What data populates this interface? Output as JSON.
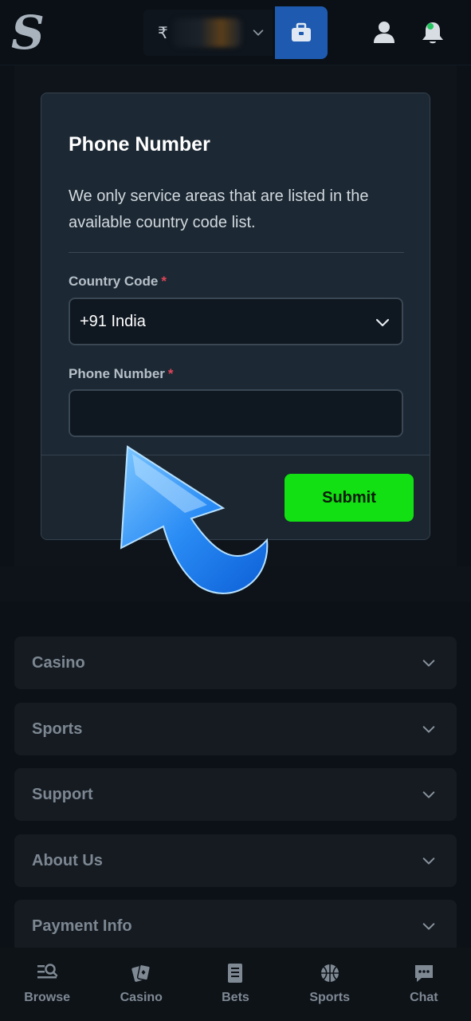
{
  "header": {
    "logo": "S",
    "currency_symbol": "₹",
    "icons": [
      "chevron-down-icon",
      "wallet-icon",
      "user-icon",
      "bell-icon"
    ]
  },
  "modal": {
    "title": "Phone Number",
    "description": "We only service areas that are listed in the available country code list.",
    "country_code_label": "Country Code",
    "country_code_value": "+91 India",
    "phone_label": "Phone Number",
    "phone_value": "",
    "required_marker": "*",
    "submit_label": "Submit"
  },
  "accordions": [
    {
      "label": "Casino"
    },
    {
      "label": "Sports"
    },
    {
      "label": "Support"
    },
    {
      "label": "About Us"
    },
    {
      "label": "Payment Info"
    }
  ],
  "bottom_nav": [
    {
      "label": "Browse",
      "icon": "browse-icon"
    },
    {
      "label": "Casino",
      "icon": "cards-icon"
    },
    {
      "label": "Bets",
      "icon": "bets-slip-icon"
    },
    {
      "label": "Sports",
      "icon": "ball-icon"
    },
    {
      "label": "Chat",
      "icon": "chat-icon"
    }
  ],
  "colors": {
    "submit": "#12e012",
    "wallet": "#1e5bb0",
    "required": "#e0455a",
    "notification_dot": "#22c55e"
  }
}
